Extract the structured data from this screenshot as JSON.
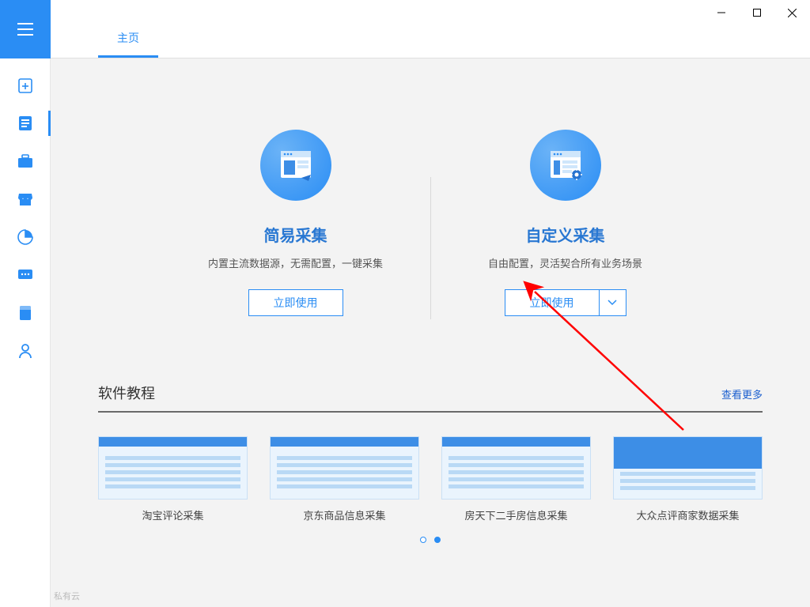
{
  "tabs": {
    "home": "主页"
  },
  "options": {
    "simple": {
      "title": "简易采集",
      "desc": "内置主流数据源，无需配置，一键采集",
      "button": "立即使用"
    },
    "custom": {
      "title": "自定义采集",
      "desc": "自由配置，灵活契合所有业务场景",
      "button": "立即使用"
    }
  },
  "tutorials": {
    "title": "软件教程",
    "more": "查看更多",
    "items": [
      {
        "name": "淘宝评论采集"
      },
      {
        "name": "京东商品信息采集"
      },
      {
        "name": "房天下二手房信息采集"
      },
      {
        "name": "大众点评商家数据采集"
      }
    ]
  },
  "footer": "私有云"
}
